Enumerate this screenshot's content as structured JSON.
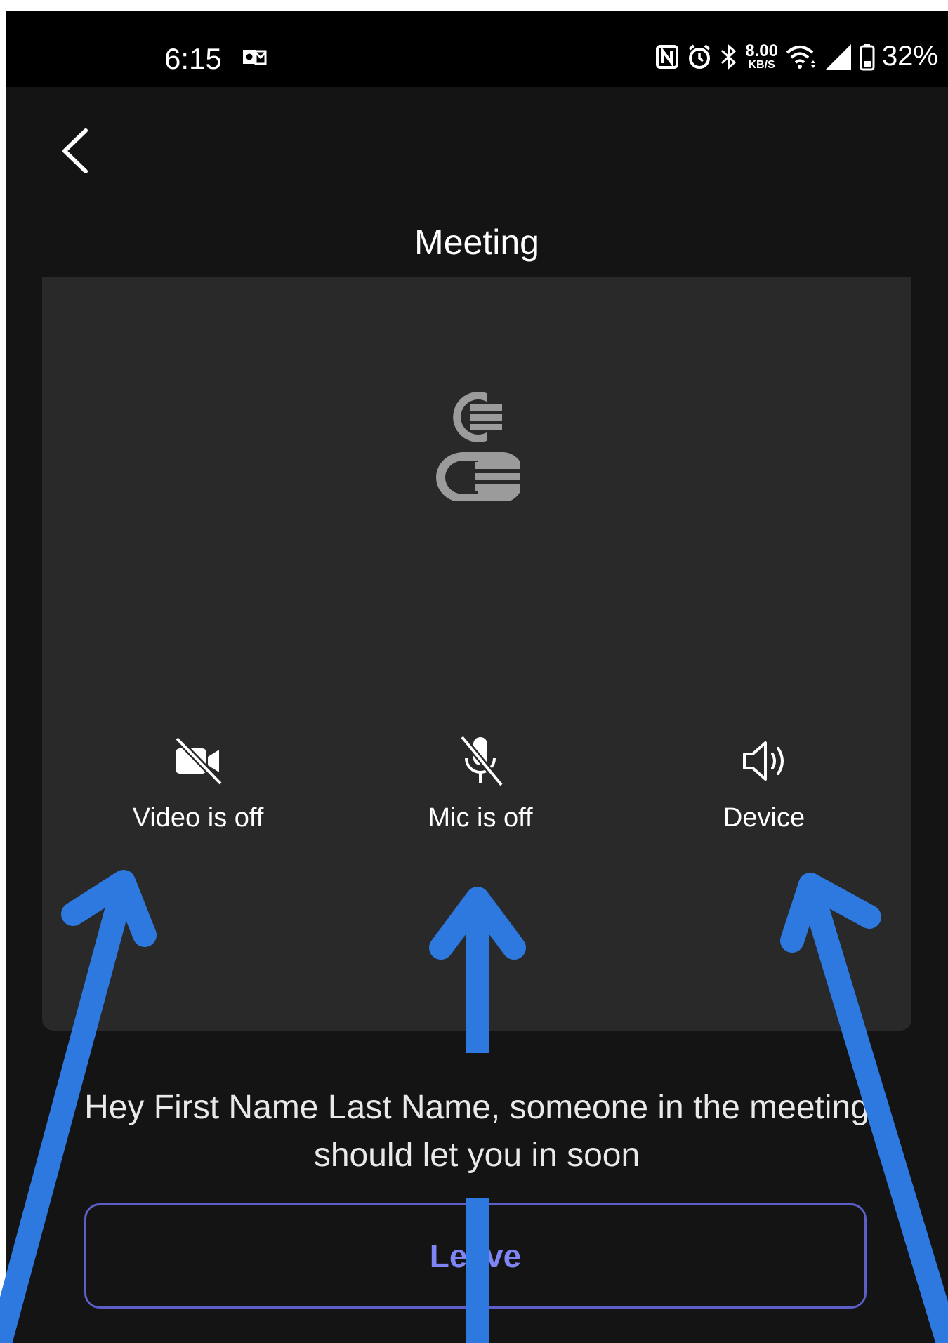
{
  "status_bar": {
    "time": "6:15",
    "speed_value": "8.00",
    "speed_unit": "KB/S",
    "battery_percent": "32%"
  },
  "header": {
    "title": "Meeting"
  },
  "controls": {
    "video_label": "Video is off",
    "mic_label": "Mic is off",
    "device_label": "Device"
  },
  "lobby_message": "Hey First Name Last Name, someone in the meeting should let you in soon",
  "leave_label": "Leave",
  "colors": {
    "background": "#141414",
    "stage": "#292929",
    "accent": "#7f85f5",
    "accent_border": "#5b5fc7",
    "annotation_arrow": "#2d79e0"
  },
  "icons": [
    "back-chevron-icon",
    "avatar-placeholder-icon",
    "video-off-icon",
    "mic-off-icon",
    "speaker-icon"
  ]
}
